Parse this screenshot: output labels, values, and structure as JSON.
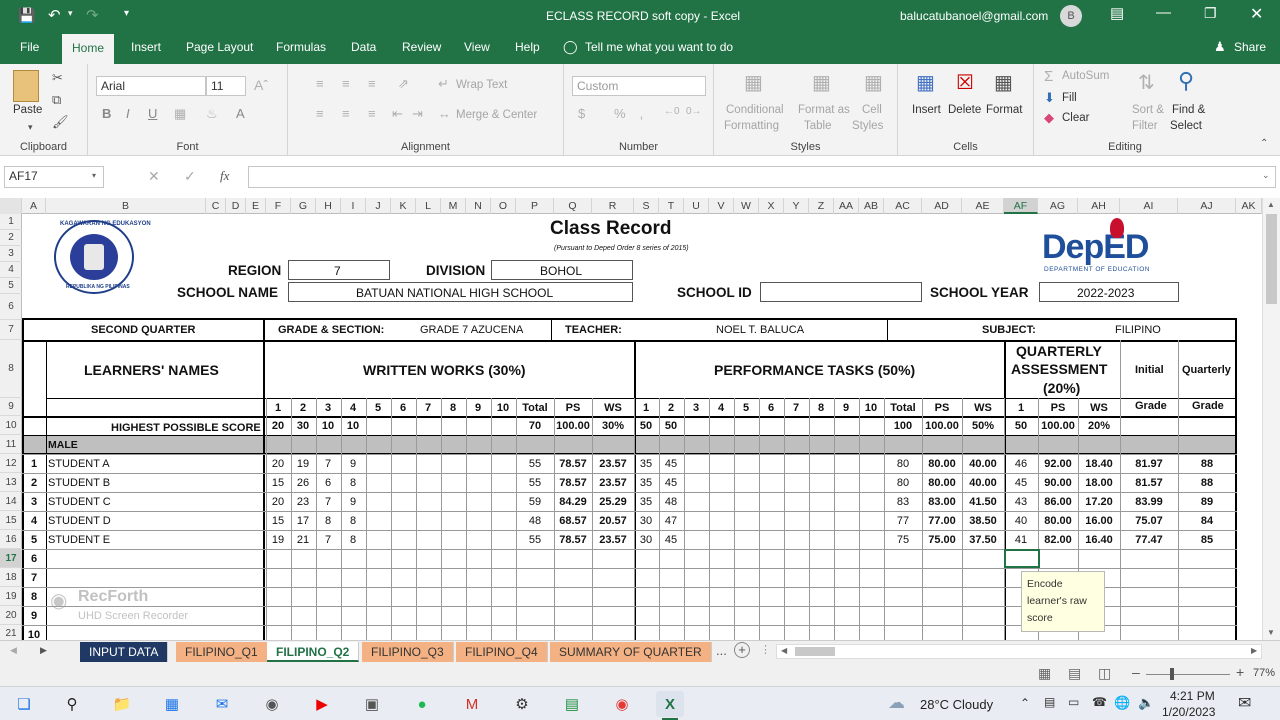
{
  "titlebar": {
    "title": "ECLASS RECORD soft copy  -  Excel",
    "account": "balucatubanoel@gmail.com",
    "avatar_initial": "B"
  },
  "ribbon_tabs": [
    "File",
    "Home",
    "Insert",
    "Page Layout",
    "Formulas",
    "Data",
    "Review",
    "View",
    "Help"
  ],
  "tell_me": "Tell me what you want to do",
  "share": "Share",
  "clipboard": {
    "paste": "Paste",
    "label": "Clipboard"
  },
  "font": {
    "name": "Arial",
    "size": "11",
    "label": "Font",
    "bold": "B",
    "italic": "I",
    "underline": "U",
    "color_a": "A"
  },
  "alignment": {
    "wrap_text": "Wrap Text",
    "merge_center": "Merge & Center",
    "label": "Alignment"
  },
  "number": {
    "format": "Custom",
    "label": "Number",
    "currency": "$",
    "percent": "%"
  },
  "styles": {
    "conditional": "Conditional",
    "conditional2": "Formatting",
    "format_as": "Format as",
    "format_as2": "Table",
    "cell": "Cell",
    "cell2": "Styles",
    "label": "Styles"
  },
  "cells": {
    "insert": "Insert",
    "delete": "Delete",
    "format": "Format",
    "label": "Cells"
  },
  "editing": {
    "autosum": "AutoSum",
    "fill": "Fill",
    "clear": "Clear",
    "sort": "Sort &",
    "sort2": "Filter",
    "find": "Find &",
    "find2": "Select",
    "label": "Editing"
  },
  "formula": {
    "name_box": "AF17",
    "fx": "fx",
    "value": ""
  },
  "columns": [
    "A",
    "B",
    "C",
    "D",
    "E",
    "F",
    "G",
    "H",
    "I",
    "J",
    "K",
    "L",
    "M",
    "N",
    "O",
    "P",
    "Q",
    "R",
    "S",
    "T",
    "U",
    "V",
    "W",
    "X",
    "Y",
    "Z",
    "AA",
    "AB",
    "AC",
    "AD",
    "AE",
    "AF",
    "AG",
    "AH",
    "AI",
    "AJ",
    "AK"
  ],
  "rows": [
    "1",
    "2",
    "3",
    "4",
    "5",
    "6",
    "7",
    "8",
    "9",
    "10",
    "11",
    "12",
    "13",
    "14",
    "15",
    "16",
    "17",
    "18",
    "19",
    "20",
    "21"
  ],
  "record": {
    "title": "Class Record",
    "subtitle": "(Pursuant to Deped Order 8 series of 2015)",
    "seal_text": "KAGAWARAN NG EDUKASYON",
    "seal_bottom": "REPUBLIKA NG PILIPINAS",
    "deped_logo": "DepED",
    "deped_sub": "DEPARTMENT OF EDUCATION",
    "region_label": "REGION",
    "region": "7",
    "division_label": "DIVISION",
    "division": "BOHOL",
    "school_label": "SCHOOL NAME",
    "school": "BATUAN NATIONAL HIGH SCHOOL",
    "school_id_label": "SCHOOL ID",
    "school_id": "",
    "school_year_label": "SCHOOL YEAR",
    "school_year": "2022-2023",
    "quarter": "SECOND QUARTER",
    "grade_section_label": "GRADE & SECTION:",
    "grade_section": "GRADE 7 AZUCENA",
    "teacher_label": "TEACHER:",
    "teacher": "NOEL T. BALUCA",
    "subject_label": "SUBJECT:",
    "subject": "FILIPINO",
    "learners_header": "LEARNERS' NAMES",
    "ww_header": "WRITTEN WORKS (30%)",
    "pt_header": "PERFORMANCE TASKS (50%)",
    "qa_header1": "QUARTERLY",
    "qa_header2": "ASSESSMENT",
    "qa_header3": "(20%)",
    "initial_header": "Initial",
    "quarterly_header": "Quarterly",
    "grade": "Grade",
    "score_nums": [
      "1",
      "2",
      "3",
      "4",
      "5",
      "6",
      "7",
      "8",
      "9",
      "10"
    ],
    "total": "Total",
    "ps": "PS",
    "ws": "WS",
    "qa_num": "1",
    "hps_label": "HIGHEST POSSIBLE SCORE",
    "hps_ww": [
      "20",
      "30",
      "10",
      "10"
    ],
    "hps_ww_total": "70",
    "hps_ww_ps": "100.00",
    "hps_ww_ws": "30%",
    "hps_pt": [
      "50",
      "50"
    ],
    "hps_pt_total": "100",
    "hps_pt_ps": "100.00",
    "hps_pt_ws": "50%",
    "hps_qa": "50",
    "hps_qa_ps": "100.00",
    "hps_qa_ws": "20%",
    "male_label": "MALE",
    "students": [
      {
        "n": "1",
        "name": "STUDENT A",
        "ww": [
          "20",
          "19",
          "7",
          "9"
        ],
        "wwt": "55",
        "wwps": "78.57",
        "wwws": "23.57",
        "pt": [
          "35",
          "45"
        ],
        "ptt": "80",
        "ptps": "80.00",
        "ptws": "40.00",
        "qa": "46",
        "qaps": "92.00",
        "qaws": "18.40",
        "ini": "81.97",
        "q": "88"
      },
      {
        "n": "2",
        "name": "STUDENT B",
        "ww": [
          "15",
          "26",
          "6",
          "8"
        ],
        "wwt": "55",
        "wwps": "78.57",
        "wwws": "23.57",
        "pt": [
          "35",
          "45"
        ],
        "ptt": "80",
        "ptps": "80.00",
        "ptws": "40.00",
        "qa": "45",
        "qaps": "90.00",
        "qaws": "18.00",
        "ini": "81.57",
        "q": "88"
      },
      {
        "n": "3",
        "name": "STUDENT C",
        "ww": [
          "20",
          "23",
          "7",
          "9"
        ],
        "wwt": "59",
        "wwps": "84.29",
        "wwws": "25.29",
        "pt": [
          "35",
          "48"
        ],
        "ptt": "83",
        "ptps": "83.00",
        "ptws": "41.50",
        "qa": "43",
        "qaps": "86.00",
        "qaws": "17.20",
        "ini": "83.99",
        "q": "89"
      },
      {
        "n": "4",
        "name": "STUDENT D",
        "ww": [
          "15",
          "17",
          "8",
          "8"
        ],
        "wwt": "48",
        "wwps": "68.57",
        "wwws": "20.57",
        "pt": [
          "30",
          "47"
        ],
        "ptt": "77",
        "ptps": "77.00",
        "ptws": "38.50",
        "qa": "40",
        "qaps": "80.00",
        "qaws": "16.00",
        "ini": "75.07",
        "q": "84"
      },
      {
        "n": "5",
        "name": "STUDENT E",
        "ww": [
          "19",
          "21",
          "7",
          "8"
        ],
        "wwt": "55",
        "wwps": "78.57",
        "wwws": "23.57",
        "pt": [
          "30",
          "45"
        ],
        "ptt": "75",
        "ptps": "75.00",
        "ptws": "37.50",
        "qa": "41",
        "qaps": "82.00",
        "qaws": "16.40",
        "ini": "77.47",
        "q": "85"
      }
    ],
    "empty_nums": [
      "6",
      "7",
      "8",
      "9",
      "10"
    ],
    "comment_l1": "Encode",
    "comment_l2": "learner's raw",
    "comment_l3": "score"
  },
  "watermark": {
    "brand": "RecForth",
    "sub": "UHD Screen Recorder"
  },
  "sheet_tabs": [
    "INPUT DATA",
    "FILIPINO_Q1",
    "FILIPINO_Q2",
    "FILIPINO_Q3",
    "FILIPINO_Q4",
    "SUMMARY OF QUARTER"
  ],
  "sheet_more": "...",
  "status": {
    "zoom": "77%"
  },
  "taskbar": {
    "weather": "28°C  Cloudy",
    "time": "4:21 PM",
    "date": "1/20/2023"
  },
  "colors": {
    "excel_green": "#217346",
    "tab_orange": "#f4b183",
    "tab_navy": "#1f3864",
    "deped_red": "#c8102e",
    "deped_blue": "#1f4e9a"
  }
}
